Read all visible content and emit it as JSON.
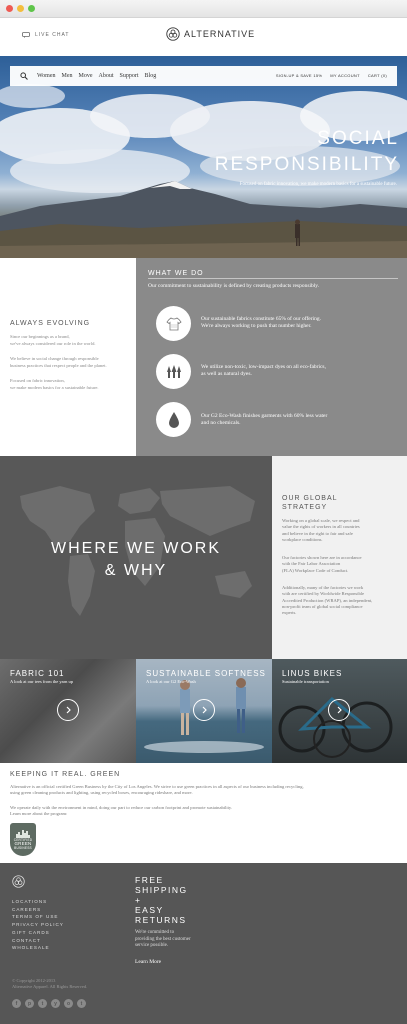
{
  "window": {
    "dot_colors": [
      "#ee5b54",
      "#f4be3e",
      "#5fc54a"
    ]
  },
  "topbar": {
    "live_chat": "LIVE CHAT",
    "logo": "ALTERNATIVE"
  },
  "nav": {
    "search_icon": "search-icon",
    "links": [
      "Women",
      "Men",
      "Move",
      "About",
      "Support",
      "Blog"
    ],
    "right_links": [
      "SIGN-UP & SAVE 15%",
      "MY ACCOUNT",
      "CART (0)"
    ]
  },
  "hero": {
    "title_line1": "SOCIAL",
    "title_line2": "RESPONSIBILITY",
    "subtitle": "Focused on fabric innovation, we make modern basics for a sustainable future."
  },
  "always_evolving": {
    "title": "ALWAYS EVOLVING",
    "p1_line1": "Since our beginnings as a brand,",
    "p1_line2": "we've always considered our role in the world.",
    "p2_line1": "We believe in social change through responsible",
    "p2_line2": "business practices that respect people and the planet.",
    "p3_line1": "Focused on fabric innovation,",
    "p3_line2": "we make modern basics for a sustainable future."
  },
  "what_we_do": {
    "title": "WHAT WE DO",
    "subtitle": "Our commitment to sustainability is defined by creating products responsibly.",
    "items": [
      {
        "icon": "tshirt-icon",
        "line1": "Our sustainable fabrics constitute 65% of our offering.",
        "line2": "We're always working to push that number higher."
      },
      {
        "icon": "trees-icon",
        "line1": "We utilize non-toxic, low-impact dyes on all eco-fabrics,",
        "line2": "as well as natural dyes."
      },
      {
        "icon": "water-drop-icon",
        "line1": "Our G2 Eco-Wash finishes garments with 60% less water",
        "line2": "and no chemicals."
      }
    ]
  },
  "where_we_work": {
    "line1": "WHERE WE WORK",
    "line2": "& WHY"
  },
  "global_strategy": {
    "title_line1": "OUR GLOBAL",
    "title_line2": "STRATEGY",
    "p1": [
      "Working on a global scale, we respect and",
      "value the rights of workers in all countries",
      "and believe in the right to fair and safe",
      "workplace conditions."
    ],
    "p2": [
      "Our factories shown here are in accordance",
      "with the Fair Labor Association",
      "(FLA) Workplace Code of Conduct."
    ],
    "p3": [
      "Additionally, many of the factories we work",
      "with are certified by Worldwide Responsible",
      "Accredited Production (WRAP), an independent,",
      "non-profit team of global social compliance",
      "experts."
    ]
  },
  "tiles": [
    {
      "title": "FABRIC 101",
      "subtitle": "A look at our tees from the yarn up"
    },
    {
      "title": "SUSTAINABLE SOFTNESS",
      "subtitle": "A look at our G2 Eco-Wash"
    },
    {
      "title": "LINUS BIKES",
      "subtitle": "Sustainable transportation"
    }
  ],
  "keeping_it_real": {
    "title": "KEEPING IT REAL. GREEN",
    "p1_line1": "Alternative is an official certified Green Business by the City of Los Angeles. We strive to use green practices in all aspects of our business including recycling,",
    "p1_line2": "using green cleaning products and lighting, using recycled boxes, encouraging rideshare, and more.",
    "p2_line1": "We operate daily with the environment in mind, doing our part to reduce our carbon footprint and promote sustainability.",
    "p2_line2": "Learn more about the program:",
    "badge_line1": "CERTIFIED",
    "badge_line2": "GREEN",
    "badge_line3": "BUSINESS"
  },
  "footer": {
    "links": [
      "LOCATIONS",
      "CAREERS",
      "TERMS OF USE",
      "PRIVACY POLICY",
      "GIFT CARDS",
      "CONTACT",
      "WHOLESALE"
    ],
    "head1": "FREE",
    "head2": "SHIPPING",
    "head3": "+",
    "head4": "EASY",
    "head5": "RETURNS",
    "text_line1": "We're committed to",
    "text_line2": "providing the best customer",
    "text_line3": "service possible.",
    "learn_more": "Learn More",
    "copyright_line1": "© Copyright 2012-2013",
    "copyright_line2": "Alternative Apparel. All Rights Reserved.",
    "social": [
      "f",
      "p",
      "t",
      "y",
      "o",
      "t"
    ]
  }
}
